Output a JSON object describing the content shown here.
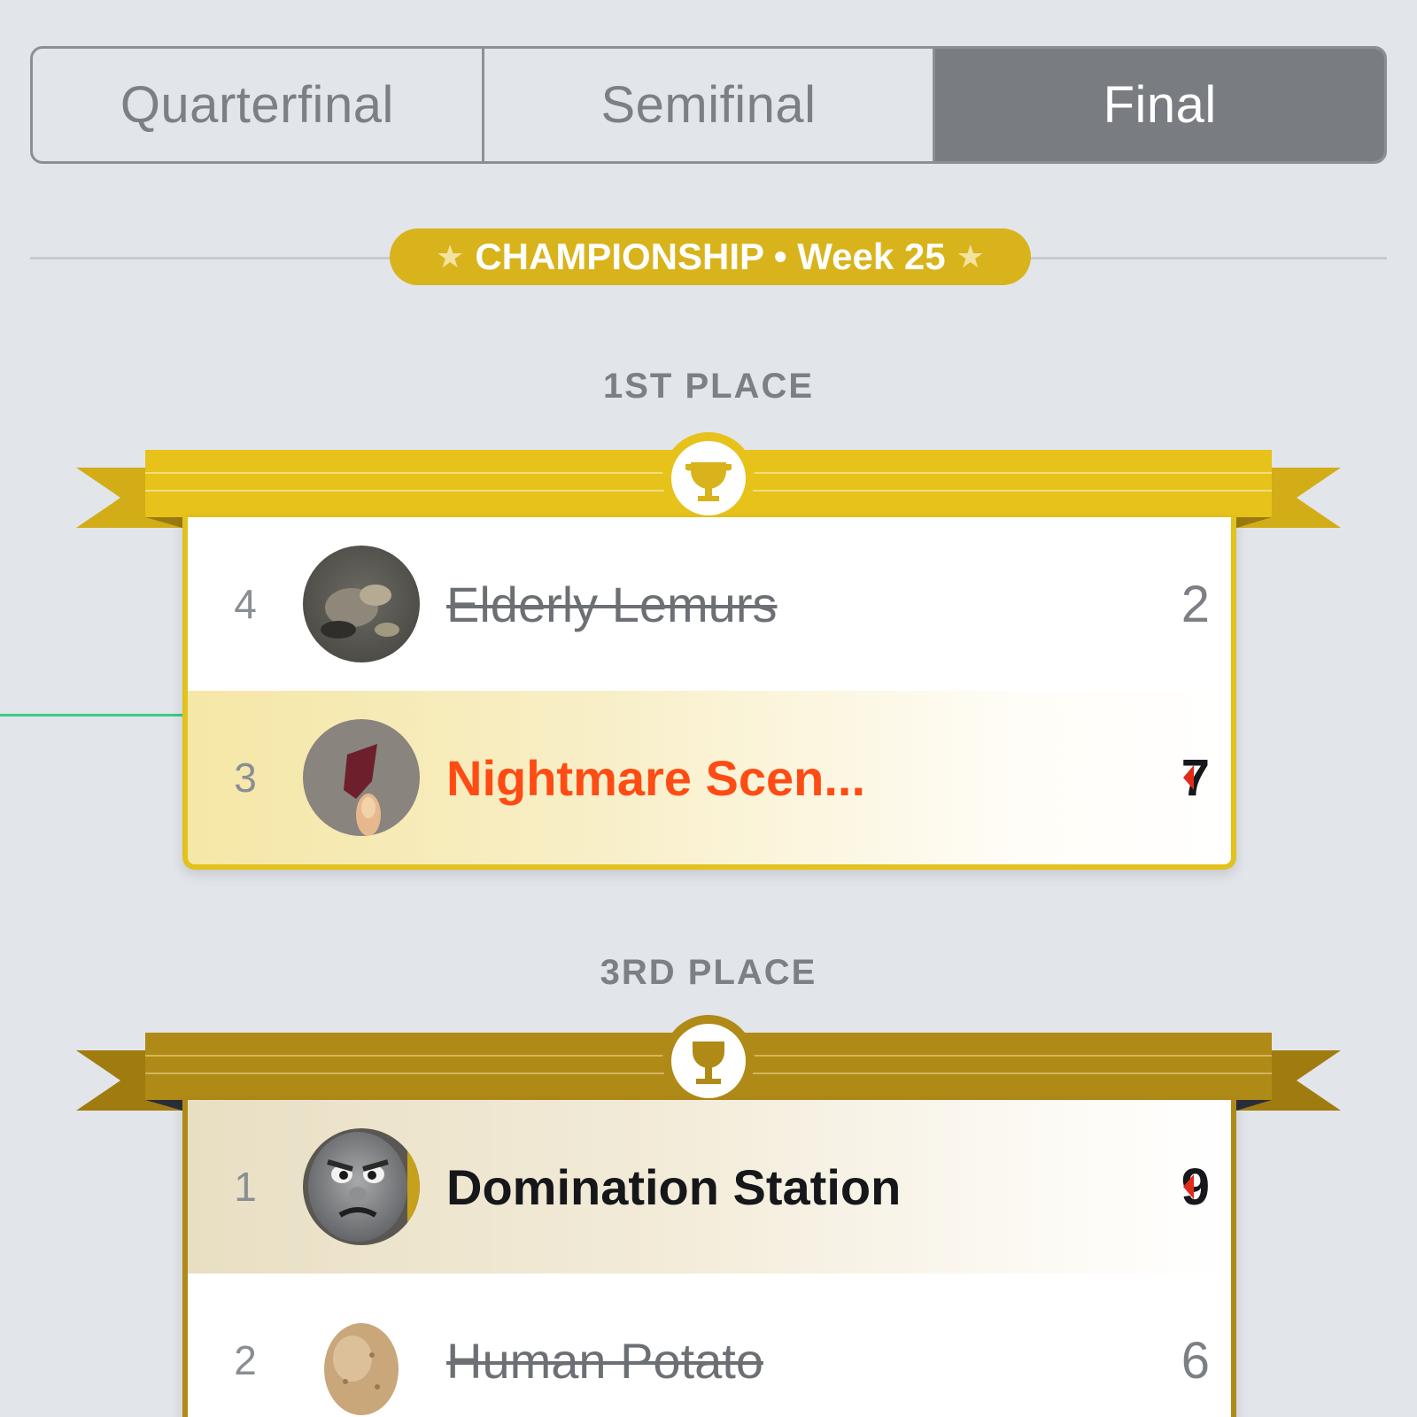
{
  "tabs": [
    {
      "label": "Quarterfinal",
      "active": false
    },
    {
      "label": "Semifinal",
      "active": false
    },
    {
      "label": "Final",
      "active": true
    }
  ],
  "banner": {
    "star": "★",
    "text": "CHAMPIONSHIP • Week 25"
  },
  "colors": {
    "gold": "#e2c21c",
    "bronze": "#b08a17",
    "winner_orange": "#ff4b14",
    "arrow_red": "#e12b1b",
    "connector_green": "#3cc986"
  },
  "first_place": {
    "label": "1ST PLACE",
    "icon": "trophy-icon",
    "teams": [
      {
        "seed": "4",
        "name": "Elderly Lemurs",
        "score": "2",
        "winner": false
      },
      {
        "seed": "3",
        "name": "Nightmare Scen...",
        "score": "7",
        "winner": true
      }
    ]
  },
  "third_place": {
    "label": "3RD PLACE",
    "icon": "goblet-icon",
    "teams": [
      {
        "seed": "1",
        "name": "Domination Station",
        "score": "9",
        "winner": true
      },
      {
        "seed": "2",
        "name": "Human Potato",
        "score": "6",
        "winner": false
      }
    ]
  }
}
